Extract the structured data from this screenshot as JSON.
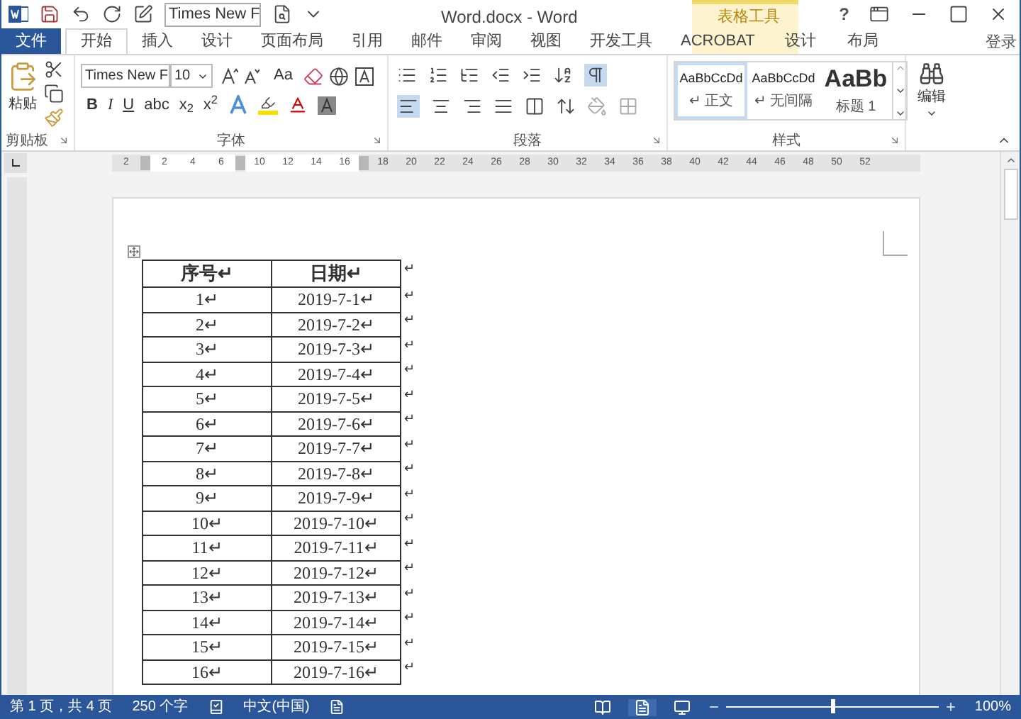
{
  "title_bar": {
    "font_box": "Times New F",
    "title": "Word.docx - Word",
    "context_group": "表格工具",
    "help": "?"
  },
  "tabs": [
    {
      "label": "文件",
      "kind": "file",
      "selected": false
    },
    {
      "label": "开始",
      "kind": "tab",
      "selected": true
    },
    {
      "label": "插入",
      "kind": "tab",
      "selected": false
    },
    {
      "label": "设计",
      "kind": "tab",
      "selected": false
    },
    {
      "label": "页面布局",
      "kind": "tab",
      "selected": false
    },
    {
      "label": "引用",
      "kind": "tab",
      "selected": false
    },
    {
      "label": "邮件",
      "kind": "tab",
      "selected": false
    },
    {
      "label": "审阅",
      "kind": "tab",
      "selected": false
    },
    {
      "label": "视图",
      "kind": "tab",
      "selected": false
    },
    {
      "label": "开发工具",
      "kind": "tab",
      "selected": false
    },
    {
      "label": "ACROBAT",
      "kind": "tab",
      "selected": false
    },
    {
      "label": "设计",
      "kind": "context",
      "selected": false
    },
    {
      "label": "布局",
      "kind": "context",
      "selected": false
    }
  ],
  "account": "登录",
  "ribbon": {
    "clipboard": {
      "paste": "粘贴",
      "label": "剪贴板"
    },
    "font": {
      "name": "Times New F",
      "size": "10",
      "change_case": "Aa",
      "label": "字体",
      "buttons": [
        "B",
        "I",
        "U",
        "abc",
        "x$_{2}$",
        "x$^{2}$"
      ]
    },
    "paragraph": {
      "label": "段落"
    },
    "styles": {
      "label": "样式",
      "items": [
        {
          "sample": "AaBbCcDd",
          "name": "↵ 正文",
          "kind": "body",
          "selected": true
        },
        {
          "sample": "AaBbCcDd",
          "name": "↵ 无间隔",
          "kind": "body",
          "selected": false
        },
        {
          "sample": "AaBb",
          "name": "标题 1",
          "kind": "heading",
          "selected": false
        }
      ]
    },
    "editing": {
      "label": "编辑"
    }
  },
  "ruler": {
    "segments": [
      {
        "kind": "margin",
        "ticks": [
          "2"
        ]
      },
      {
        "kind": "text",
        "ticks": [
          "2",
          "4",
          "6"
        ]
      },
      {
        "kind": "text",
        "ticks": [
          "10",
          "12",
          "14",
          "16"
        ]
      },
      {
        "kind": "margin",
        "ticks": [
          "18",
          "20",
          "22",
          "24",
          "26",
          "28",
          "30",
          "32",
          "34",
          "36",
          "38",
          "40",
          "42",
          "44",
          "46",
          "48",
          "50",
          "52"
        ]
      }
    ]
  },
  "table": {
    "columns": [
      "序号↵",
      "日期↵"
    ],
    "header_end": "↵",
    "rows": [
      {
        "cells": [
          "1↵",
          "2019-7-1↵"
        ],
        "end": "↵"
      },
      {
        "cells": [
          "2↵",
          "2019-7-2↵"
        ],
        "end": "↵"
      },
      {
        "cells": [
          "3↵",
          "2019-7-3↵"
        ],
        "end": "↵"
      },
      {
        "cells": [
          "4↵",
          "2019-7-4↵"
        ],
        "end": "↵"
      },
      {
        "cells": [
          "5↵",
          "2019-7-5↵"
        ],
        "end": "↵"
      },
      {
        "cells": [
          "6↵",
          "2019-7-6↵"
        ],
        "end": "↵"
      },
      {
        "cells": [
          "7↵",
          "2019-7-7↵"
        ],
        "end": "↵"
      },
      {
        "cells": [
          "8↵",
          "2019-7-8↵"
        ],
        "end": "↵"
      },
      {
        "cells": [
          "9↵",
          "2019-7-9↵"
        ],
        "end": "↵"
      },
      {
        "cells": [
          "10↵",
          "2019-7-10↵"
        ],
        "end": "↵"
      },
      {
        "cells": [
          "11↵",
          "2019-7-11↵"
        ],
        "end": "↵"
      },
      {
        "cells": [
          "12↵",
          "2019-7-12↵"
        ],
        "end": "↵"
      },
      {
        "cells": [
          "13↵",
          "2019-7-13↵"
        ],
        "end": "↵"
      },
      {
        "cells": [
          "14↵",
          "2019-7-14↵"
        ],
        "end": "↵"
      },
      {
        "cells": [
          "15↵",
          "2019-7-15↵"
        ],
        "end": "↵"
      },
      {
        "cells": [
          "16↵",
          "2019-7-16↵"
        ],
        "end": "↵"
      }
    ]
  },
  "status_bar": {
    "page": "第 1 页，共 4 页",
    "words": "250 个字",
    "language": "中文(中国)",
    "zoom": "100%",
    "zoom_slider": {
      "level": 0.5
    }
  }
}
